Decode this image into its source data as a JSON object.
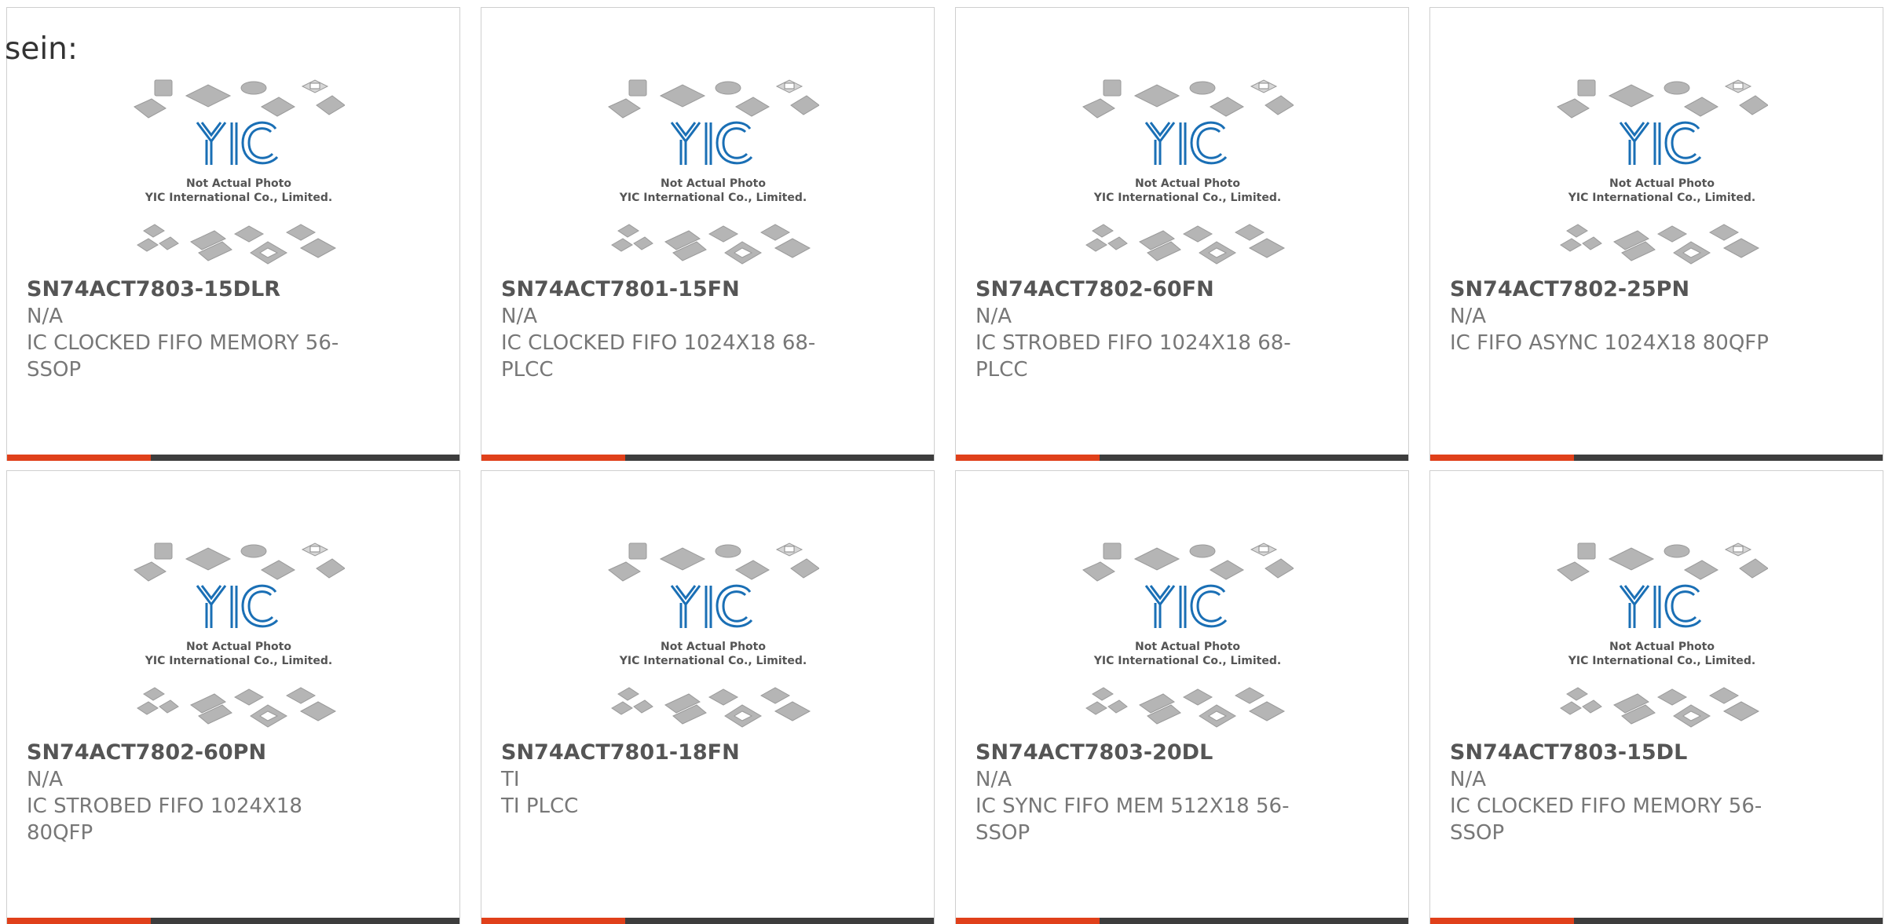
{
  "intro_text": "sein:",
  "placeholder": {
    "line1": "Not Actual Photo",
    "line2": "YIC International Co., Limited.",
    "logo": "YIC"
  },
  "colors": {
    "accent": "#e0401a",
    "bar": "#3d3d3d",
    "logo_blue": "#1a6fb5"
  },
  "products": [
    {
      "part": "SN74ACT7803-15DLR",
      "mfr": "N/A",
      "desc": "IC CLOCKED FIFO MEMORY 56-SSOP"
    },
    {
      "part": "SN74ACT7801-15FN",
      "mfr": "N/A",
      "desc": "IC CLOCKED FIFO 1024X18 68-PLCC"
    },
    {
      "part": "SN74ACT7802-60FN",
      "mfr": "N/A",
      "desc": "IC STROBED FIFO 1024X18 68-PLCC"
    },
    {
      "part": "SN74ACT7802-25PN",
      "mfr": "N/A",
      "desc": "IC FIFO ASYNC 1024X18 80QFP"
    },
    {
      "part": "SN74ACT7802-60PN",
      "mfr": "N/A",
      "desc": "IC STROBED FIFO 1024X18 80QFP"
    },
    {
      "part": "SN74ACT7801-18FN",
      "mfr": "TI",
      "desc": "TI PLCC"
    },
    {
      "part": "SN74ACT7803-20DL",
      "mfr": "N/A",
      "desc": "IC SYNC FIFO MEM 512X18 56-SSOP"
    },
    {
      "part": "SN74ACT7803-15DL",
      "mfr": "N/A",
      "desc": "IC CLOCKED FIFO MEMORY 56-SSOP"
    }
  ]
}
